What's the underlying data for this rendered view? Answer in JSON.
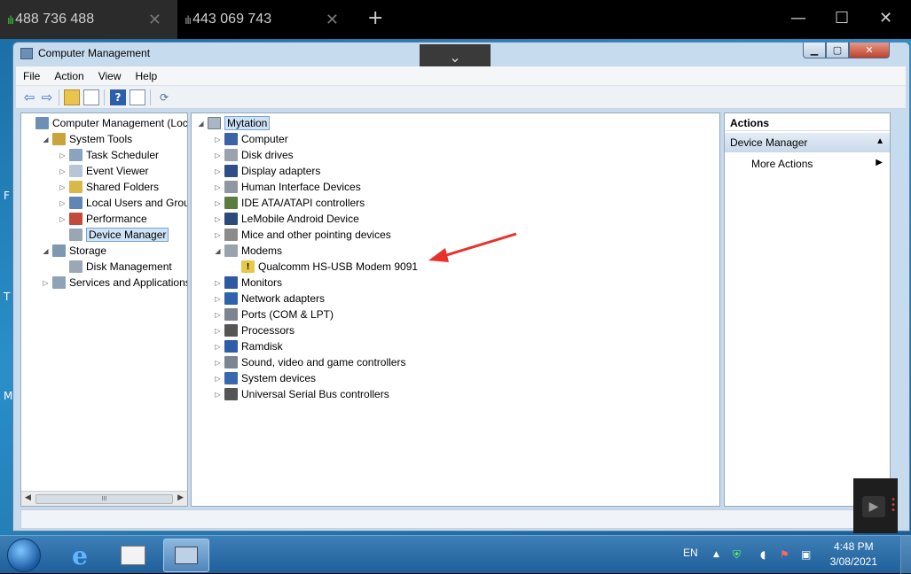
{
  "tabs": [
    {
      "label": "488 736 488",
      "signal": "ılı",
      "signal_color": "#33cc33"
    },
    {
      "label": "443 069 743",
      "signal": "ılı",
      "signal_color": "#999999"
    }
  ],
  "window": {
    "title": "Computer Management",
    "menu": [
      "File",
      "Action",
      "View",
      "Help"
    ]
  },
  "left_tree": [
    {
      "label": "Computer Management (Local",
      "depth": 0,
      "expander": "",
      "icon": "computer-management-icon"
    },
    {
      "label": "System Tools",
      "depth": 1,
      "expander": "◢",
      "icon": "system-tools-icon"
    },
    {
      "label": "Task Scheduler",
      "depth": 2,
      "expander": "▷",
      "icon": "task-scheduler-icon"
    },
    {
      "label": "Event Viewer",
      "depth": 2,
      "expander": "▷",
      "icon": "event-viewer-icon"
    },
    {
      "label": "Shared Folders",
      "depth": 2,
      "expander": "▷",
      "icon": "shared-folders-icon"
    },
    {
      "label": "Local Users and Groups",
      "depth": 2,
      "expander": "▷",
      "icon": "local-users-icon"
    },
    {
      "label": "Performance",
      "depth": 2,
      "expander": "▷",
      "icon": "performance-icon"
    },
    {
      "label": "Device Manager",
      "depth": 2,
      "expander": "",
      "icon": "device-manager-icon",
      "selected": true
    },
    {
      "label": "Storage",
      "depth": 1,
      "expander": "◢",
      "icon": "storage-icon"
    },
    {
      "label": "Disk Management",
      "depth": 2,
      "expander": "",
      "icon": "disk-management-icon"
    },
    {
      "label": "Services and Applications",
      "depth": 1,
      "expander": "▷",
      "icon": "services-icon"
    }
  ],
  "device_tree": {
    "root": "Mytation",
    "items": [
      {
        "label": "Computer",
        "depth": 1,
        "expander": "▷",
        "icon": "computer-icon"
      },
      {
        "label": "Disk drives",
        "depth": 1,
        "expander": "▷",
        "icon": "disk-drive-icon"
      },
      {
        "label": "Display adapters",
        "depth": 1,
        "expander": "▷",
        "icon": "display-adapter-icon"
      },
      {
        "label": "Human Interface Devices",
        "depth": 1,
        "expander": "▷",
        "icon": "hid-icon"
      },
      {
        "label": "IDE ATA/ATAPI controllers",
        "depth": 1,
        "expander": "▷",
        "icon": "ide-controller-icon"
      },
      {
        "label": "LeMobile Android Device",
        "depth": 1,
        "expander": "▷",
        "icon": "android-device-icon"
      },
      {
        "label": "Mice and other pointing devices",
        "depth": 1,
        "expander": "▷",
        "icon": "mouse-icon"
      },
      {
        "label": "Modems",
        "depth": 1,
        "expander": "◢",
        "icon": "modem-icon"
      },
      {
        "label": "Qualcomm HS-USB Modem 9091",
        "depth": 2,
        "expander": "",
        "icon": "modem-warning-icon"
      },
      {
        "label": "Monitors",
        "depth": 1,
        "expander": "▷",
        "icon": "monitor-icon"
      },
      {
        "label": "Network adapters",
        "depth": 1,
        "expander": "▷",
        "icon": "network-adapter-icon"
      },
      {
        "label": "Ports (COM & LPT)",
        "depth": 1,
        "expander": "▷",
        "icon": "ports-icon"
      },
      {
        "label": "Processors",
        "depth": 1,
        "expander": "▷",
        "icon": "processor-icon"
      },
      {
        "label": "Ramdisk",
        "depth": 1,
        "expander": "▷",
        "icon": "ramdisk-icon"
      },
      {
        "label": "Sound, video and game controllers",
        "depth": 1,
        "expander": "▷",
        "icon": "sound-icon"
      },
      {
        "label": "System devices",
        "depth": 1,
        "expander": "▷",
        "icon": "system-devices-icon"
      },
      {
        "label": "Universal Serial Bus controllers",
        "depth": 1,
        "expander": "▷",
        "icon": "usb-icon"
      }
    ]
  },
  "actions": {
    "header": "Actions",
    "section": "Device Manager",
    "more": "More Actions"
  },
  "hscroll_thumb": "III",
  "taskbar": {
    "lang": "EN",
    "time": "4:48 PM",
    "date": "3/08/2021"
  },
  "colors": {
    "accent": "#cfe3f7",
    "annotation": "#e8312a"
  }
}
